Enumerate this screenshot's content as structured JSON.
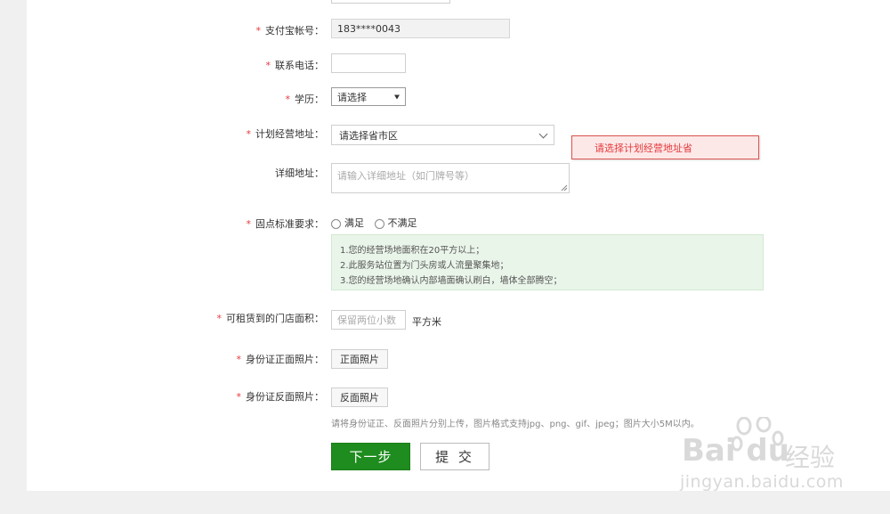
{
  "form": {
    "required_mark": "*",
    "alipay": {
      "label": "支付宝帐号：",
      "value": "183****0043"
    },
    "phone": {
      "label": "联系电话：",
      "value": ""
    },
    "education": {
      "label": "学历：",
      "selected": "请选择"
    },
    "address": {
      "label": "计划经营地址：",
      "selected": "请选择省市区",
      "error": "请选择计划经营地址省"
    },
    "detail_address": {
      "label": "详细地址：",
      "placeholder": "请输入详细地址（如门牌号等）"
    },
    "standard": {
      "label": "固点标准要求：",
      "options": [
        "满足",
        "不满足"
      ],
      "notes": [
        "1.您的经营场地面积在20平方以上；",
        "2.此服务站位置为门头房或人流量聚集地；",
        "3.您的经营场地确认内部墙面确认刷白，墙体全部腾空；"
      ]
    },
    "area": {
      "label": "可租赁到的门店面积：",
      "placeholder": "保留两位小数",
      "unit": "平方米"
    },
    "id_front": {
      "label": "身份证正面照片：",
      "button": "正面照片"
    },
    "id_back": {
      "label": "身份证反面照片：",
      "button": "反面照片"
    },
    "upload_hint": "请将身份证正、反面照片分别上传，图片格式支持jpg、png、gif、jpeg；图片大小5M以内。",
    "next_button": "下一步",
    "submit_button": "提 交"
  },
  "watermark": {
    "logo_text": "Bai du",
    "brand": "经验",
    "url": "jingyan.baidu.com"
  },
  "colors": {
    "primary": "#1e8c1e",
    "required": "#e4393c",
    "error_bg": "#fde8e8",
    "notice_bg": "#eaf5ea"
  }
}
